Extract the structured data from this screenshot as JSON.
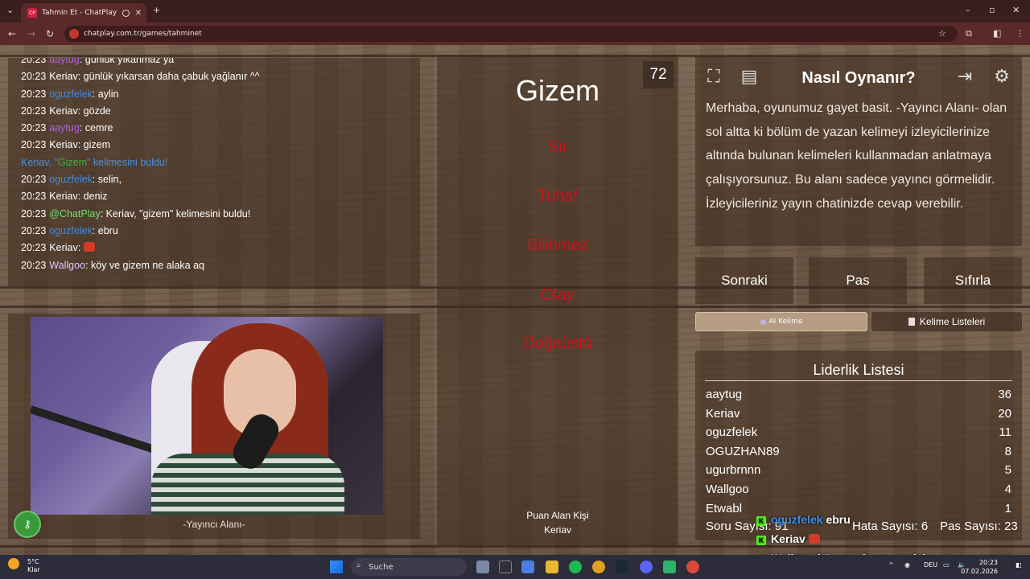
{
  "browser": {
    "tab_title": "Tahmin Et - ChatPlay",
    "tab_favicon": "CP",
    "url": "chatplay.com.tr/games/tahminet"
  },
  "chat": {
    "lines": [
      {
        "time": "20:23",
        "user": "aaytug",
        "color": "#b060e0",
        "msg": "günlük yıkanmaz ya"
      },
      {
        "time": "20:23",
        "user": "Keriav",
        "color": "#ffffff",
        "msg": "günlük yıkarsan daha çabuk yağlanır ^^"
      },
      {
        "time": "20:23",
        "user": "oguzfelek",
        "color": "#3c8be6",
        "msg": "aylin"
      },
      {
        "time": "20:23",
        "user": "Keriav",
        "color": "#ffffff",
        "msg": "gözde"
      },
      {
        "time": "20:23",
        "user": "aaytug",
        "color": "#b060e0",
        "msg": "cemre"
      },
      {
        "time": "20:23",
        "user": "Keriav",
        "color": "#ffffff",
        "msg": "gizem"
      },
      {
        "system": true,
        "text_before": "Keriav, \"",
        "word": "Gizem",
        "text_after": "\" kelimesini buldu!"
      },
      {
        "time": "20:23",
        "user": "oguzfelek",
        "color": "#3c8be6",
        "msg": "selin,"
      },
      {
        "time": "20:23",
        "user": "Keriav",
        "color": "#ffffff",
        "msg": "deniz"
      },
      {
        "time": "20:23",
        "user": "@ChatPlay",
        "color": "#6fe06f",
        "msg": "Keriav, \"gizem\" kelimesini buldu!"
      },
      {
        "time": "20:23",
        "user": "oguzfelek",
        "color": "#3c8be6",
        "msg": "ebru"
      },
      {
        "time": "20:23",
        "user": "Keriav",
        "color": "#ffffff",
        "msg": "",
        "emote": true
      },
      {
        "time": "20:23",
        "user": "Wallgoo",
        "color": "#d8c8ff",
        "msg": "köy ve gizem ne alaka aq"
      }
    ]
  },
  "streamer": {
    "label": "-Yayıncı Alanı-"
  },
  "card": {
    "timer": "72",
    "word": "Gizem",
    "forbidden": [
      "Sır",
      "Tuhaf",
      "Bilinmez",
      "Olay",
      "Doğaüstü"
    ],
    "scorer_label": "Puan Alan Kişi",
    "scorer_name": "Keriav"
  },
  "info": {
    "title": "Nasıl Oynanır?",
    "text": "Merhaba, oyunumuz gayet basit. -Yayıncı Alanı- olan sol altta ki bölüm de yazan kelimeyi izleyicilerinize altında bulunan kelimeleri kullanmadan anlatmaya çalışıyorsunuz. Bu alanı sadece yayıncı görmelidir. İzleyicileriniz yayın chatinizde cevap verebilir."
  },
  "actions": {
    "next": "Sonraki",
    "pass": "Pas",
    "reset": "Sıfırla",
    "ai_word": "AI Kelime",
    "word_lists": "Kelime Listeleri"
  },
  "leaderboard": {
    "title": "Liderlik Listesi",
    "rows": [
      {
        "name": "aaytug",
        "score": "36"
      },
      {
        "name": "Keriav",
        "score": "20"
      },
      {
        "name": "oguzfelek",
        "score": "11"
      },
      {
        "name": "OGUZHAN89",
        "score": "8"
      },
      {
        "name": "ugurbrnnn",
        "score": "5"
      },
      {
        "name": "Wallgoo",
        "score": "4"
      },
      {
        "name": "Etwabl",
        "score": "1"
      }
    ],
    "question_count": "Soru Sayısı: 91",
    "error_count": "Hata Sayısı: 6",
    "pass_count": "Pas Sayısı: 23"
  },
  "overlay_chat": [
    {
      "user": "oguzfelek",
      "msg": "ebru"
    },
    {
      "user": "Keriav",
      "msg": ""
    },
    {
      "user": "Wallgoo",
      "msg": "köy ve gizem ne alaka aq"
    }
  ],
  "taskbar": {
    "temp": "5°C",
    "weather": "Klar",
    "search": "Suche",
    "lang": "DEU",
    "time": "20:23",
    "date": "07.02.2026"
  }
}
